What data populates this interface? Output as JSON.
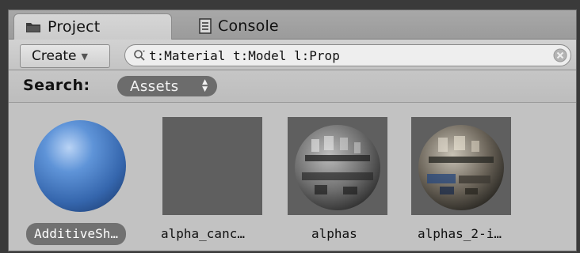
{
  "tabs": [
    {
      "label": "Project",
      "icon": "folder-icon",
      "active": true
    },
    {
      "label": "Console",
      "icon": "console-icon",
      "active": false
    }
  ],
  "toolbar": {
    "create_label": "Create",
    "search_value": "t:Material t:Model l:Prop"
  },
  "scope": {
    "label": "Search:",
    "selected": "Assets"
  },
  "assets": [
    {
      "name": "AdditiveSh…",
      "preview": "blue-sphere",
      "selected": true
    },
    {
      "name": "alpha_canc…",
      "preview": "empty-gray",
      "selected": false
    },
    {
      "name": "alphas",
      "preview": "textured-sphere",
      "selected": false
    },
    {
      "name": "alphas_2-i…",
      "preview": "textured-sphere-color",
      "selected": false
    }
  ],
  "colors": {
    "window_bg": "#c2c2c2",
    "tab_bar": "#9f9f9f",
    "selection_pill": "#717171",
    "sphere_blue": "#4a7fc4"
  }
}
